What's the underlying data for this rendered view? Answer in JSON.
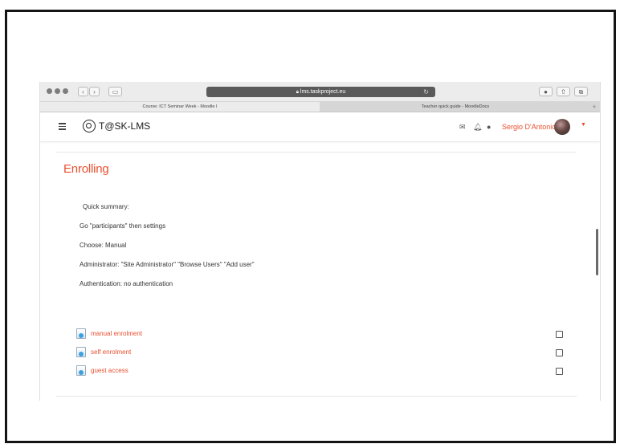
{
  "browser": {
    "url": "lms.taskproject.eu",
    "tabs": [
      {
        "label": "Course: ICT Seminar Week - Moodle I",
        "active": true
      },
      {
        "label": "Teacher quick guide - MoodleDocs",
        "active": false
      }
    ],
    "icons": [
      "back-icon",
      "forward-icon",
      "sidebar-icon",
      "reload-icon",
      "download-icon",
      "share-icon",
      "tabs-icon",
      "new-tab-icon"
    ]
  },
  "appbar": {
    "site_name": "T@SK-LMS",
    "user_name": "Sergio D'Antonio",
    "icons": [
      "menu-icon",
      "logo-icon",
      "mail-icon",
      "bell-icon",
      "chat-icon",
      "avatar",
      "caret-icon"
    ]
  },
  "section": {
    "heading": "Enrolling",
    "lines": [
      "Quick summary:",
      "Go \"participants\" then  settings",
      "Choose: Manual",
      "Administrator: \"Site Administrator\" \"Browse Users\" \"Add user\"",
      "Authentication: no authentication"
    ],
    "activities": [
      {
        "label": "manual enrolment",
        "completed": false
      },
      {
        "label": "self enrolment",
        "completed": false
      },
      {
        "label": "guest access",
        "completed": false
      }
    ]
  },
  "colors": {
    "accent": "#e8502f",
    "frame": "#141414",
    "url_bar": "#5a5a5a"
  }
}
